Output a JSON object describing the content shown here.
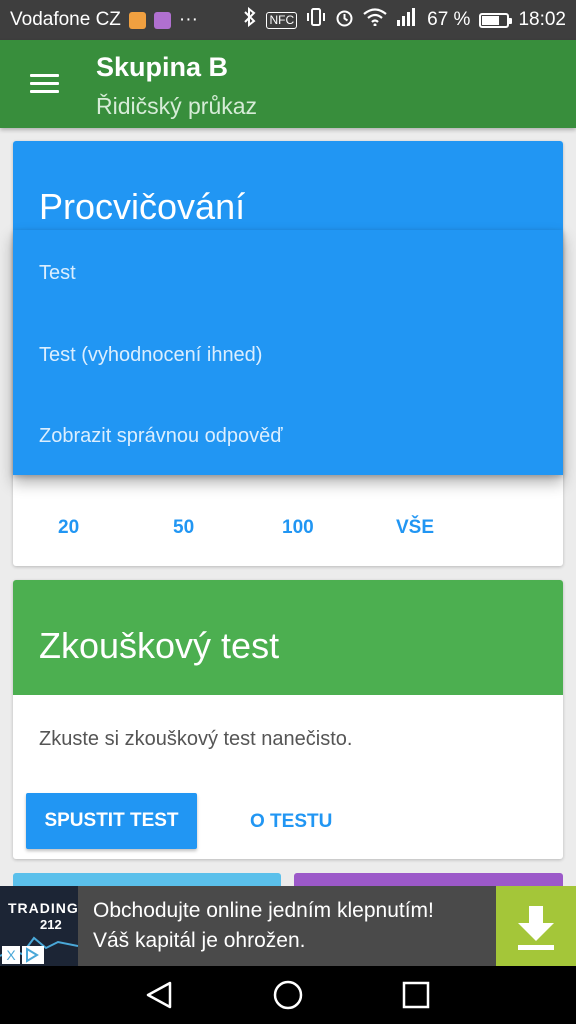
{
  "status_bar": {
    "carrier": "Vodafone CZ",
    "overflow": "···",
    "battery_text": "67 %",
    "battery_level": 0.67,
    "time": "18:02",
    "icons": [
      "bluetooth-icon",
      "nfc-icon",
      "vibrate-icon",
      "alarm-icon",
      "wifi-icon",
      "signal-icon",
      "battery-icon"
    ],
    "nfc_label": "NFC"
  },
  "app_bar": {
    "title": "Skupina B",
    "subtitle": "Řidičský průkaz"
  },
  "practice_card": {
    "title": "Procvičování",
    "color": "#2196f3",
    "dropdown_items": [
      "Test",
      "Test (vyhodnocení ihned)",
      "Zobrazit správnou odpověď"
    ],
    "counts": [
      "20",
      "50",
      "100",
      "VŠE"
    ]
  },
  "exam_card": {
    "title": "Zkouškový test",
    "color": "#4caf50",
    "description": "Zkuste si zkouškový test nanečisto.",
    "primary_button": "SPUSTIT TEST",
    "secondary_button": "O TESTU"
  },
  "peek_cards": {
    "left_color": "#5bc0eb",
    "right_color": "#9c59c9"
  },
  "ad": {
    "logo_top": "TRADING",
    "logo_bottom": "212",
    "line1": "Obchodujte online jedním klepnutím!",
    "line2": "Váš kapitál je ohrožen.",
    "close_glyph": "X"
  },
  "nav_bar": {
    "buttons": [
      "back-icon",
      "home-icon",
      "recents-icon"
    ]
  },
  "colors": {
    "primary_dark": "#388e3c",
    "accent": "#2196f3"
  }
}
